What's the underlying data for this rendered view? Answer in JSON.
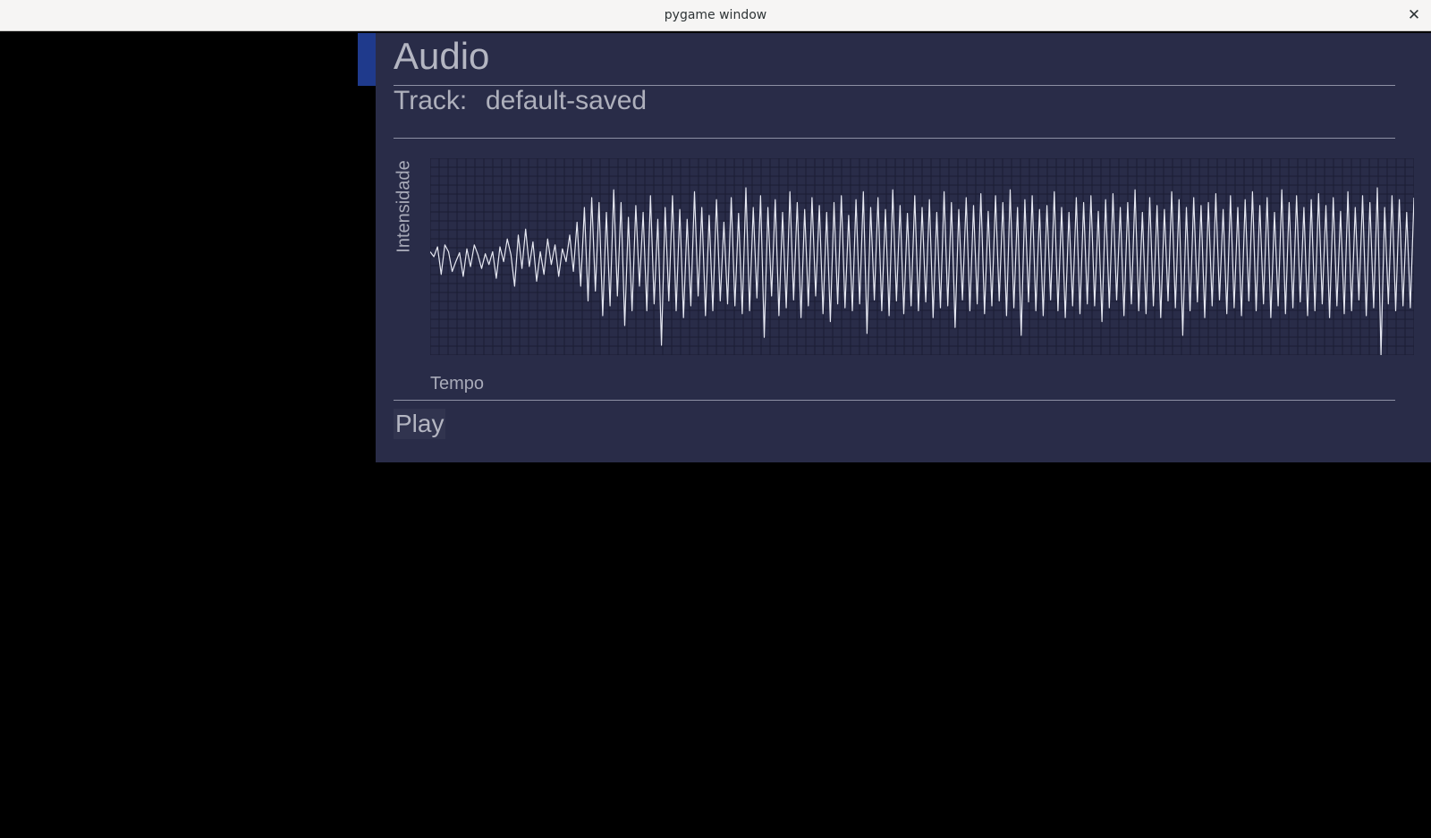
{
  "window": {
    "title": "pygame window",
    "close_glyph": "✕",
    "close_icon": "close-icon"
  },
  "colors": {
    "panel_bg": "#292c48",
    "accent": "#1f3a8c",
    "waveform": "#e6e8f2",
    "grid": "#1b1d33",
    "text": "#b4b6c2"
  },
  "panel": {
    "heading": "Audio",
    "track_label": "Track:",
    "track_value": "default-saved",
    "play_label": "Play"
  },
  "chart_data": {
    "type": "line",
    "title": "",
    "xlabel": "Tempo",
    "ylabel": "Intensidade",
    "grid": true,
    "legend": "none",
    "x_tick_labels": false,
    "y_tick_labels": false,
    "ylim": [
      -1,
      1
    ],
    "series": [
      {
        "values": [
          0.05,
          0.0,
          0.1,
          -0.18,
          0.12,
          0.05,
          -0.15,
          -0.05,
          0.04,
          -0.2,
          0.08,
          -0.1,
          0.12,
          0.02,
          -0.12,
          0.03,
          -0.08,
          0.05,
          -0.22,
          0.1,
          -0.05,
          0.18,
          0.02,
          -0.3,
          0.22,
          -0.12,
          0.28,
          -0.1,
          0.15,
          -0.25,
          0.05,
          -0.18,
          0.18,
          -0.08,
          0.12,
          -0.2,
          0.08,
          -0.05,
          0.22,
          -0.15,
          0.35,
          -0.3,
          0.5,
          -0.45,
          0.6,
          -0.35,
          0.55,
          -0.6,
          0.45,
          -0.5,
          0.68,
          -0.4,
          0.55,
          -0.7,
          0.4,
          -0.55,
          0.52,
          -0.3,
          0.45,
          -0.55,
          0.62,
          -0.48,
          0.38,
          -0.9,
          0.5,
          -0.45,
          0.62,
          -0.55,
          0.48,
          -0.62,
          0.38,
          -0.5,
          0.66,
          -0.4,
          0.5,
          -0.6,
          0.42,
          -0.55,
          0.58,
          -0.45,
          0.35,
          -0.48,
          0.6,
          -0.5,
          0.44,
          -0.58,
          0.7,
          -0.55,
          0.5,
          -0.42,
          0.62,
          -0.82,
          0.5,
          -0.4,
          0.58,
          -0.6,
          0.45,
          -0.52,
          0.66,
          -0.44,
          0.55,
          -0.62,
          0.48,
          -0.5,
          0.6,
          -0.4,
          0.52,
          -0.58,
          0.45,
          -0.66,
          0.55,
          -0.48,
          0.62,
          -0.52,
          0.42,
          -0.55,
          0.58,
          -0.48,
          0.66,
          -0.78,
          0.5,
          -0.44,
          0.6,
          -0.55,
          0.48,
          -0.6,
          0.68,
          -0.45,
          0.52,
          -0.58,
          0.44,
          -0.5,
          0.62,
          -0.55,
          0.5,
          -0.46,
          0.58,
          -0.62,
          0.45,
          -0.52,
          0.66,
          -0.5,
          0.55,
          -0.72,
          0.48,
          -0.44,
          0.6,
          -0.55,
          0.52,
          -0.48,
          0.64,
          -0.58,
          0.46,
          -0.5,
          0.62,
          -0.45,
          0.55,
          -0.6,
          0.68,
          -0.52,
          0.5,
          -0.8,
          0.58,
          -0.46,
          0.62,
          -0.55,
          0.48,
          -0.6,
          0.52,
          -0.44,
          0.66,
          -0.55,
          0.5,
          -0.62,
          0.45,
          -0.5,
          0.6,
          -0.58,
          0.55,
          -0.48,
          0.62,
          -0.5,
          0.46,
          -0.66,
          0.58,
          -0.52,
          0.64,
          -0.44,
          0.5,
          -0.6,
          0.55,
          -0.48,
          0.68,
          -0.55,
          0.45,
          -0.58,
          0.6,
          -0.5,
          0.52,
          -0.62,
          0.48,
          -0.45,
          0.66,
          -0.52,
          0.58,
          -0.8,
          0.5,
          -0.55,
          0.6,
          -0.46,
          0.52,
          -0.62,
          0.55,
          -0.5,
          0.64,
          -0.44,
          0.48,
          -0.58,
          0.62,
          -0.52,
          0.5,
          -0.6,
          0.58,
          -0.45,
          0.66,
          -0.55,
          0.52,
          -0.48,
          0.6,
          -0.62,
          0.45,
          -0.5,
          0.68,
          -0.58,
          0.55,
          -0.52,
          0.62,
          -0.46,
          0.5,
          -0.6,
          0.58,
          -0.55,
          0.64,
          -0.48,
          0.52,
          -0.62,
          0.6,
          -0.5,
          0.46,
          -0.58,
          0.66,
          -0.55,
          0.5,
          -0.44,
          0.62,
          -0.6,
          0.55,
          -0.52,
          0.7,
          -1.0,
          0.5,
          -0.48,
          0.62,
          -0.55,
          0.58,
          -0.5,
          0.45,
          -0.52,
          0.6
        ]
      }
    ]
  }
}
